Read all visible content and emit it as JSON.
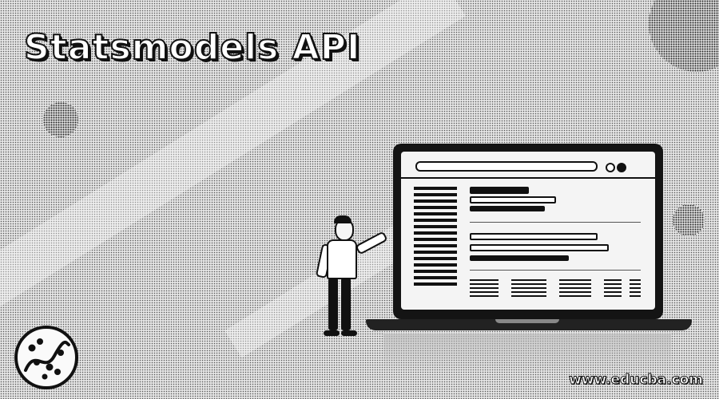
{
  "title": "Statsmodels API",
  "watermark": "www.educba.com",
  "icons": {
    "logo": "scatter-plot-curve-logo",
    "illustration": "person-presenting-laptop"
  }
}
